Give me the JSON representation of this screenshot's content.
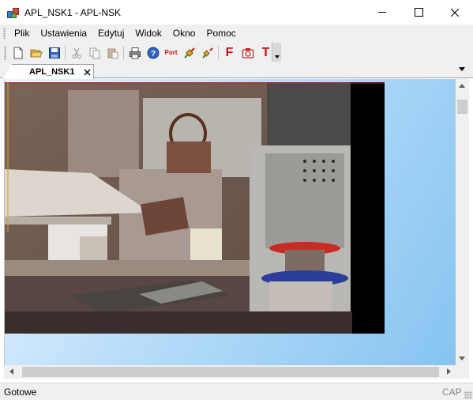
{
  "window": {
    "title": "APL_NSK1 - APL-NSK",
    "app_icon": "app-icon"
  },
  "menu": {
    "items": [
      {
        "label": "Plik"
      },
      {
        "label": "Ustawienia"
      },
      {
        "label": "Edytuj"
      },
      {
        "label": "Widok"
      },
      {
        "label": "Okno"
      },
      {
        "label": "Pomoc"
      }
    ]
  },
  "toolbar": {
    "icons": [
      "new-file-icon",
      "open-folder-icon",
      "save-icon",
      "cut-icon",
      "copy-icon",
      "paste-icon",
      "print-icon",
      "help-icon",
      "port-icon",
      "connect-icon",
      "disconnect-icon",
      "font-icon",
      "camera-icon",
      "text-icon"
    ],
    "port_label": "Port",
    "f_label": "F",
    "t_label": "T"
  },
  "tabs": {
    "active": "APL_NSK1"
  },
  "status": {
    "text": "Gotowe",
    "cap": "CAP"
  },
  "colors": {
    "toolbar_red": "#d01010",
    "client_gradient_light": "#eaf5ff",
    "client_gradient_dark": "#86c4f0"
  }
}
